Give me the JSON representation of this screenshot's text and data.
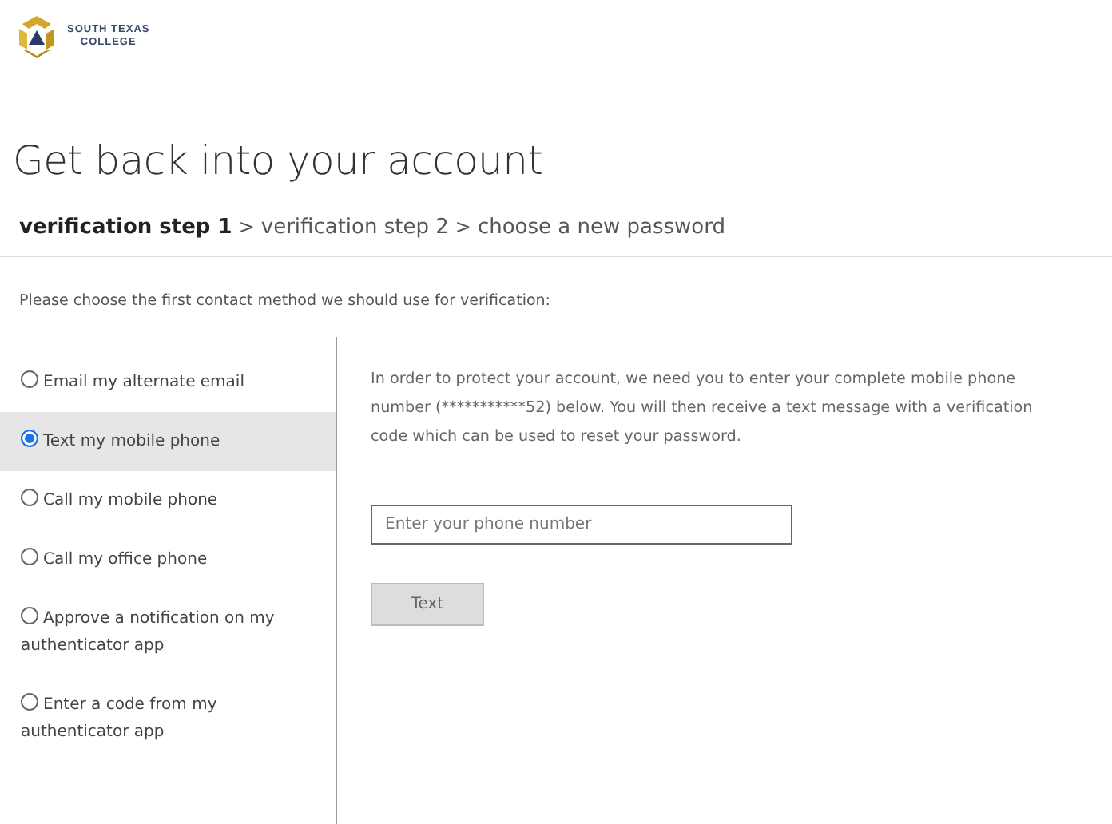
{
  "logo": {
    "line_1": "SOUTH TEXAS",
    "line_2": "COLLEGE"
  },
  "title": "Get back into your account",
  "steps": [
    {
      "label": "verification step 1",
      "selected": true
    },
    {
      "label": "verification step 2",
      "selected": false
    },
    {
      "label": "choose a new password",
      "selected": false
    }
  ],
  "step_separator": ">",
  "instruction": "Please choose the first contact method we should use for verification:",
  "options": [
    {
      "label": "Email my alternate email",
      "selected": false
    },
    {
      "label": "Text my mobile phone",
      "selected": true
    },
    {
      "label": "Call my mobile phone",
      "selected": false
    },
    {
      "label": "Call my office phone",
      "selected": false
    },
    {
      "label": "Approve a notification on my authenticator app",
      "selected": false
    },
    {
      "label": "Enter a code from my authenticator app",
      "selected": false
    }
  ],
  "detail": {
    "message": "In order to protect your account, we need you to enter your complete mobile phone number (***********52) below. You will then receive a text message with a verification code which can be used to reset your password.",
    "phone_field": {
      "placeholder": "Enter your phone number"
    },
    "button": "Text"
  }
}
